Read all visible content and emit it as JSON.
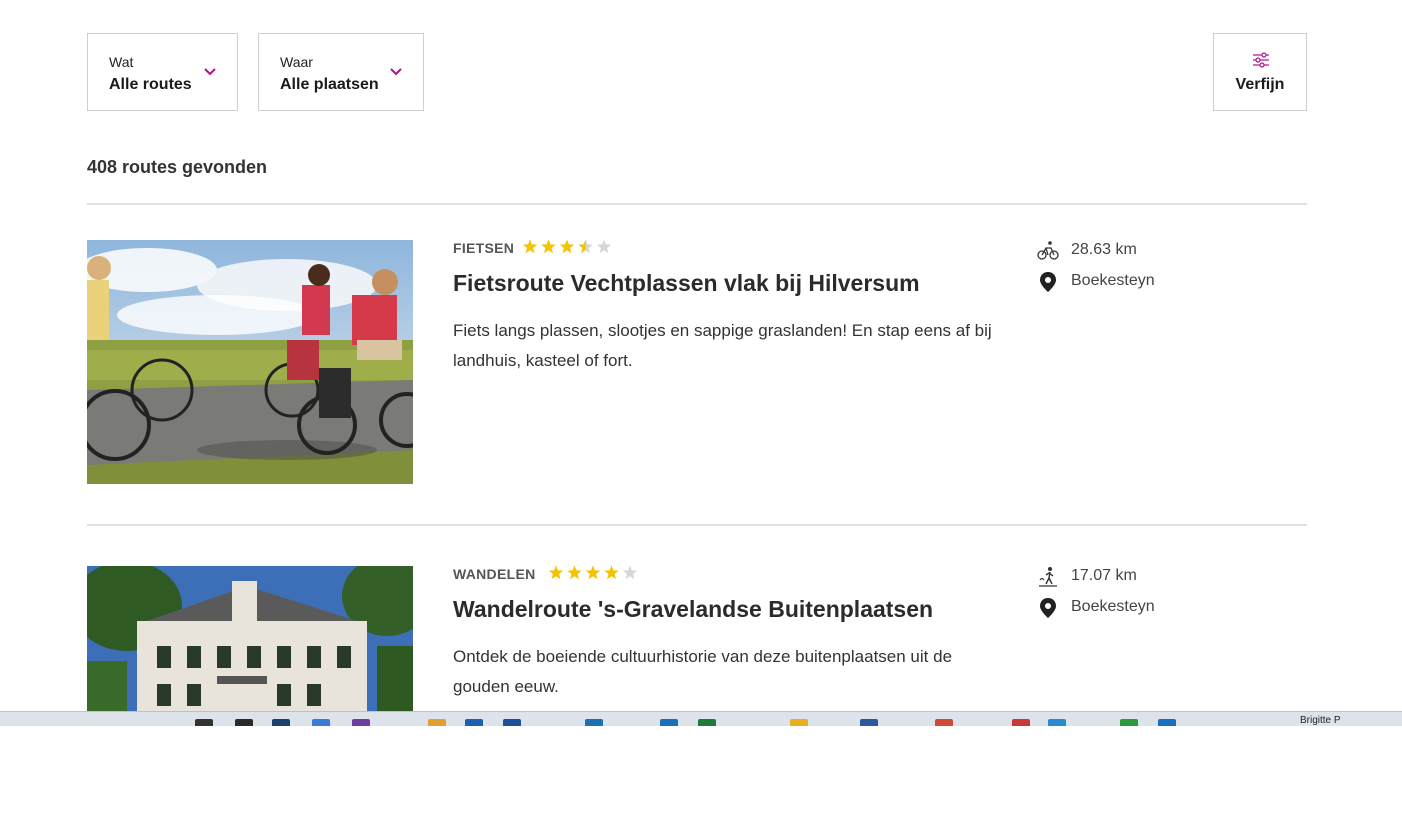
{
  "filters": {
    "wat": {
      "label": "Wat",
      "value": "Alle routes"
    },
    "waar": {
      "label": "Waar",
      "value": "Alle plaatsen"
    },
    "refine": {
      "label": "Verfijn"
    }
  },
  "results_count": "408 routes gevonden",
  "accent_color": "#b0128a",
  "star_color": "#f5c400",
  "routes": [
    {
      "category": "FIETSEN",
      "rating": 3.5,
      "rating_max": 5,
      "title": "Fietsroute Vechtplassen vlak bij Hilversum",
      "description": "Fiets langs plassen, slootjes en sappige graslanden! En stap eens af bij landhuis, kasteel of fort.",
      "distance": "28.63 km",
      "distance_icon": "bicycle-icon",
      "location": "Boekesteyn",
      "location_icon": "map-pin-icon"
    },
    {
      "category": "WANDELEN",
      "rating": 4,
      "rating_max": 5,
      "title": "Wandelroute 's-Gravelandse Buitenplaatsen",
      "description": "Ontdek de boeiende cultuurhistorie van deze buitenplaatsen uit de gouden eeuw.",
      "distance": "17.07 km",
      "distance_icon": "walking-icon",
      "location": "Boekesteyn",
      "location_icon": "map-pin-icon"
    }
  ],
  "taskbar": {
    "user_name": "Brigitte P"
  }
}
